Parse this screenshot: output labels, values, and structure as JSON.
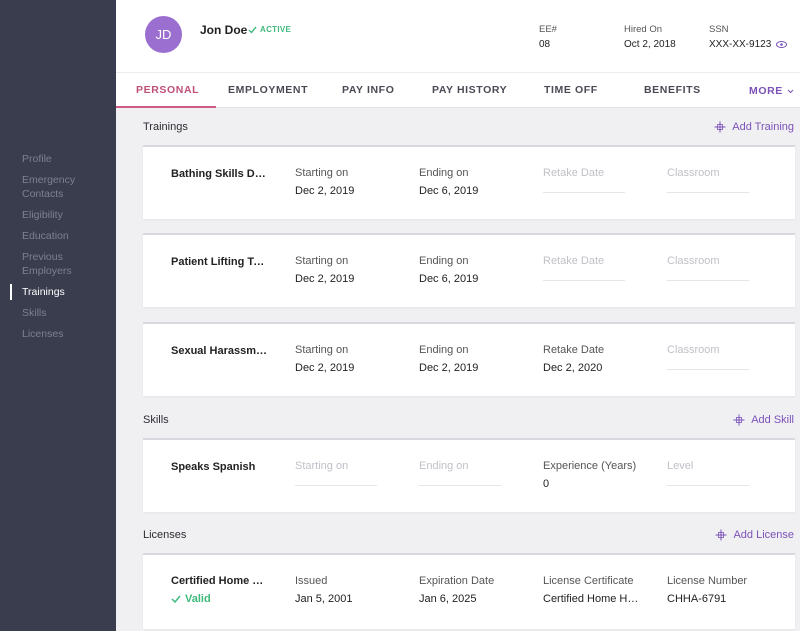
{
  "sidebar": {
    "items": [
      {
        "label": "Profile",
        "active": false
      },
      {
        "label": "Emergency\nContacts",
        "active": false
      },
      {
        "label": "Eligibility",
        "active": false
      },
      {
        "label": "Education",
        "active": false
      },
      {
        "label": "Previous\nEmployers",
        "active": false
      },
      {
        "label": "Trainings",
        "active": true
      },
      {
        "label": "Skills",
        "active": false
      },
      {
        "label": "Licenses",
        "active": false
      }
    ]
  },
  "header": {
    "avatar_initials": "JD",
    "name": "Jon Doe",
    "status": "ACTIVE",
    "ee_label": "EE#",
    "ee_value": "08",
    "hired_label": "Hired On",
    "hired_value": "Oct 2, 2018",
    "ssn_label": "SSN",
    "ssn_value": "XXX-XX-9123"
  },
  "tabs": [
    {
      "label": "PERSONAL",
      "active": true
    },
    {
      "label": "EMPLOYMENT",
      "active": false
    },
    {
      "label": "PAY INFO",
      "active": false
    },
    {
      "label": "PAY HISTORY",
      "active": false
    },
    {
      "label": "TIME OFF",
      "active": false
    },
    {
      "label": "BENEFITS",
      "active": false
    }
  ],
  "more_label": "MORE",
  "trainings": {
    "title": "Trainings",
    "add_label": "Add Training",
    "rows": [
      {
        "name": "Bathing Skills Demonstration",
        "start_label": "Starting on",
        "start": "Dec 2, 2019",
        "end_label": "Ending on",
        "end": "Dec 6, 2019",
        "retake_label": "Retake Date",
        "retake": "",
        "classroom_label": "Classroom",
        "classroom": ""
      },
      {
        "name": "Patient Lifting Techniques",
        "start_label": "Starting on",
        "start": "Dec 2, 2019",
        "end_label": "Ending on",
        "end": "Dec 6, 2019",
        "retake_label": "Retake Date",
        "retake": "",
        "classroom_label": "Classroom",
        "classroom": ""
      },
      {
        "name": "Sexual Harassment Prevention",
        "start_label": "Starting on",
        "start": "Dec 2, 2019",
        "end_label": "Ending on",
        "end": "Dec 2, 2019",
        "retake_label": "Retake Date",
        "retake": "Dec 2, 2020",
        "classroom_label": "Classroom",
        "classroom": ""
      }
    ]
  },
  "skills": {
    "title": "Skills",
    "add_label": "Add Skill",
    "rows": [
      {
        "name": "Speaks Spanish",
        "start_label": "Starting on",
        "end_label": "Ending on",
        "experience_label": "Experience (Years)",
        "experience": "0",
        "level_label": "Level"
      }
    ]
  },
  "licenses": {
    "title": "Licenses",
    "add_label": "Add License",
    "rows": [
      {
        "name": "Certified Home Health Aide",
        "status": "Valid",
        "issued_label": "Issued",
        "issued": "Jan 5, 2001",
        "expiration_label": "Expiration Date",
        "expiration": "Jan 6, 2025",
        "certificate_label": "License Certificate",
        "certificate": "Certified Home Health Aide",
        "number_label": "License Number",
        "number": "CHHA-6791"
      }
    ]
  },
  "colors": {
    "sidebar_bg": "#3a3d4e",
    "accent_purple": "#7b52b8",
    "active_tab": "#c0507a",
    "valid_green": "#3fb97c",
    "avatar": "#9b6fd0"
  }
}
